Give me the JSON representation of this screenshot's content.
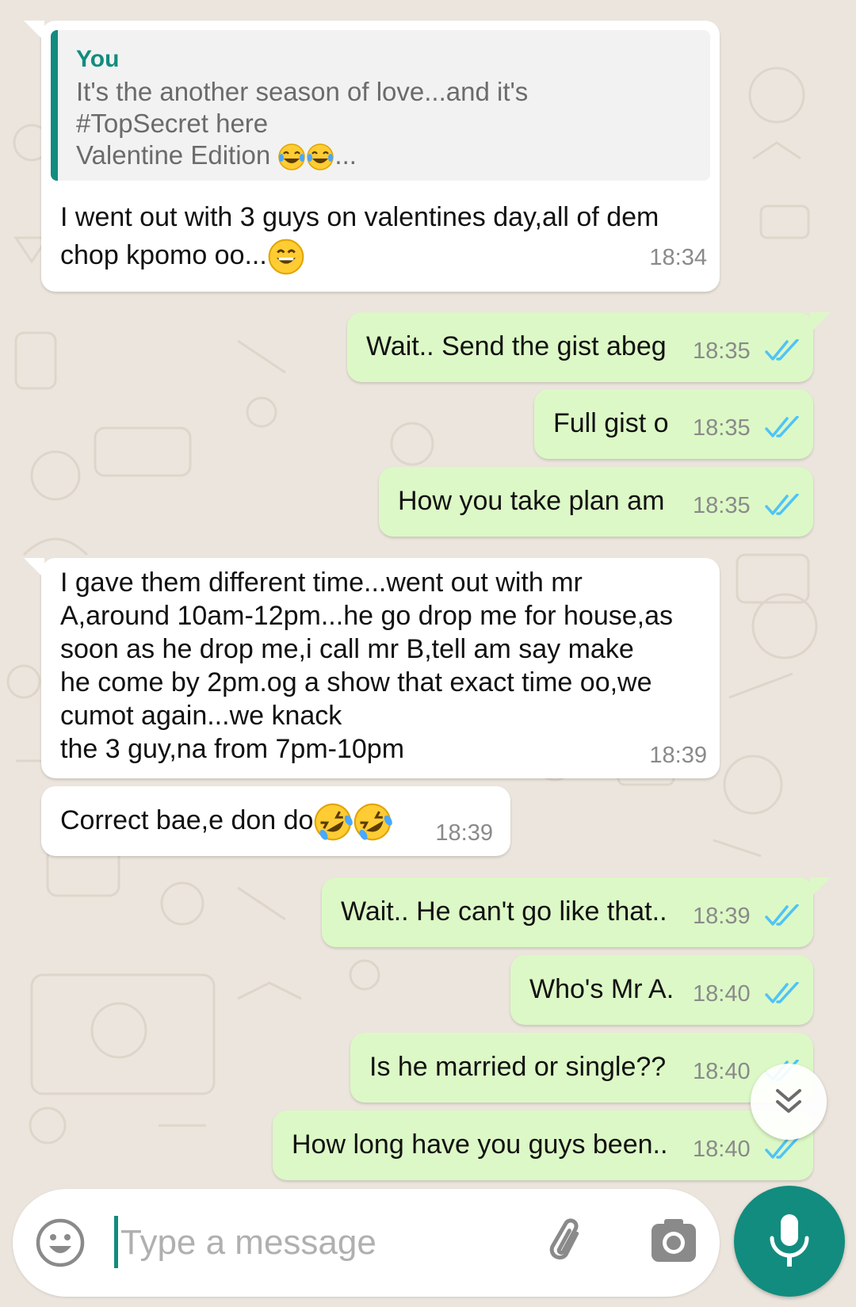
{
  "colors": {
    "background": "#ece5dd",
    "incoming_bubble": "#ffffff",
    "outgoing_bubble": "#dcf8c6",
    "accent": "#128c7e",
    "read_ticks": "#4fc3f7",
    "timestamp": "#8a8a8a"
  },
  "messages": [
    {
      "direction": "incoming",
      "reply_to": {
        "author": "You",
        "text_lines": [
          "It's the another season of love...and it's",
          "#TopSecret here",
          "Valentine Edition"
        ],
        "trailing_emojis": [
          "face-with-tears-of-joy",
          "face-with-tears-of-joy"
        ],
        "ellipsis": "..."
      },
      "text_lines": [
        "I went out with 3 guys on valentines day,all of dem",
        "chop kpomo oo..."
      ],
      "trailing_emoji": "grinning-face-with-smiling-eyes",
      "time": "18:34"
    },
    {
      "direction": "outgoing",
      "text": "Wait.. Send the gist abeg",
      "time": "18:35",
      "status": "read"
    },
    {
      "direction": "outgoing",
      "text": "Full gist o",
      "time": "18:35",
      "status": "read"
    },
    {
      "direction": "outgoing",
      "text": "How you take plan am",
      "time": "18:35",
      "status": "read"
    },
    {
      "direction": "incoming",
      "text_lines": [
        "I gave them different time...went out with mr",
        "A,around 10am-12pm...he go drop me for house,as",
        "soon as he drop me,i call mr B,tell am say make",
        "he come by 2pm.og a show that exact time oo,we",
        "cumot again...we knack",
        "the 3 guy,na from 7pm-10pm"
      ],
      "time": "18:39"
    },
    {
      "direction": "incoming",
      "text": "Correct bae,e don do",
      "trailing_emojis": [
        "rolling-on-the-floor-laughing",
        "rolling-on-the-floor-laughing"
      ],
      "time": "18:39"
    },
    {
      "direction": "outgoing",
      "text": "Wait.. He can't go like that..",
      "time": "18:39",
      "status": "read"
    },
    {
      "direction": "outgoing",
      "text": "Who's Mr A.",
      "time": "18:40",
      "status": "read"
    },
    {
      "direction": "outgoing",
      "text": "Is he married or single??",
      "time": "18:40",
      "status": "read"
    },
    {
      "direction": "outgoing",
      "text": "How long have you guys been..",
      "time": "18:40",
      "status": "read"
    }
  ],
  "composer": {
    "placeholder": "Type a message",
    "value": "",
    "icons": [
      "smiley-icon",
      "paperclip-icon",
      "camera-icon"
    ]
  },
  "scroll_button_icon": "double-chevron-down-icon",
  "send_button_icon": "microphone-icon"
}
